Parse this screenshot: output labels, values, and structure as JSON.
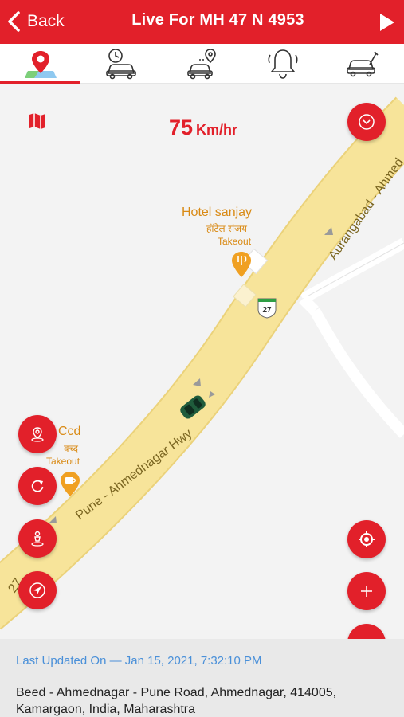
{
  "header": {
    "back_label": "Back",
    "title": "Live For MH 47 N 4953"
  },
  "tabs": [
    {
      "icon": "map-location-icon",
      "active": true
    },
    {
      "icon": "car-history-clock-icon",
      "active": false
    },
    {
      "icon": "car-route-pin-icon",
      "active": false
    },
    {
      "icon": "bell-alert-icon",
      "active": false
    },
    {
      "icon": "car-service-wrench-icon",
      "active": false
    }
  ],
  "map": {
    "speed_value": "75",
    "speed_unit": "Km/hr",
    "road_main": "Pune - Ahmednagar Hwy",
    "road_upper": "Aurangabad - Ahmed",
    "road_lower_fragment": "27",
    "highway_shield": "27",
    "poi_hotel": {
      "name": "Hotel sanjay",
      "local": "हॉटेल संजय",
      "tag": "Takeout"
    },
    "poi_ccd": {
      "name": "Ccd",
      "local": "क्च्द",
      "tag": "Takeout"
    }
  },
  "info": {
    "last_updated": "Last Updated On — Jan 15, 2021, 7:32:10 PM",
    "address_line1": "Beed - Ahmednagar - Pune Road, Ahmednagar, 414005,",
    "address_line2": "Kamargaon, India, Maharashtra"
  },
  "colors": {
    "accent": "#e2202a",
    "road": "#f7e49a",
    "poi": "#d98a14",
    "link": "#4a90d9"
  }
}
